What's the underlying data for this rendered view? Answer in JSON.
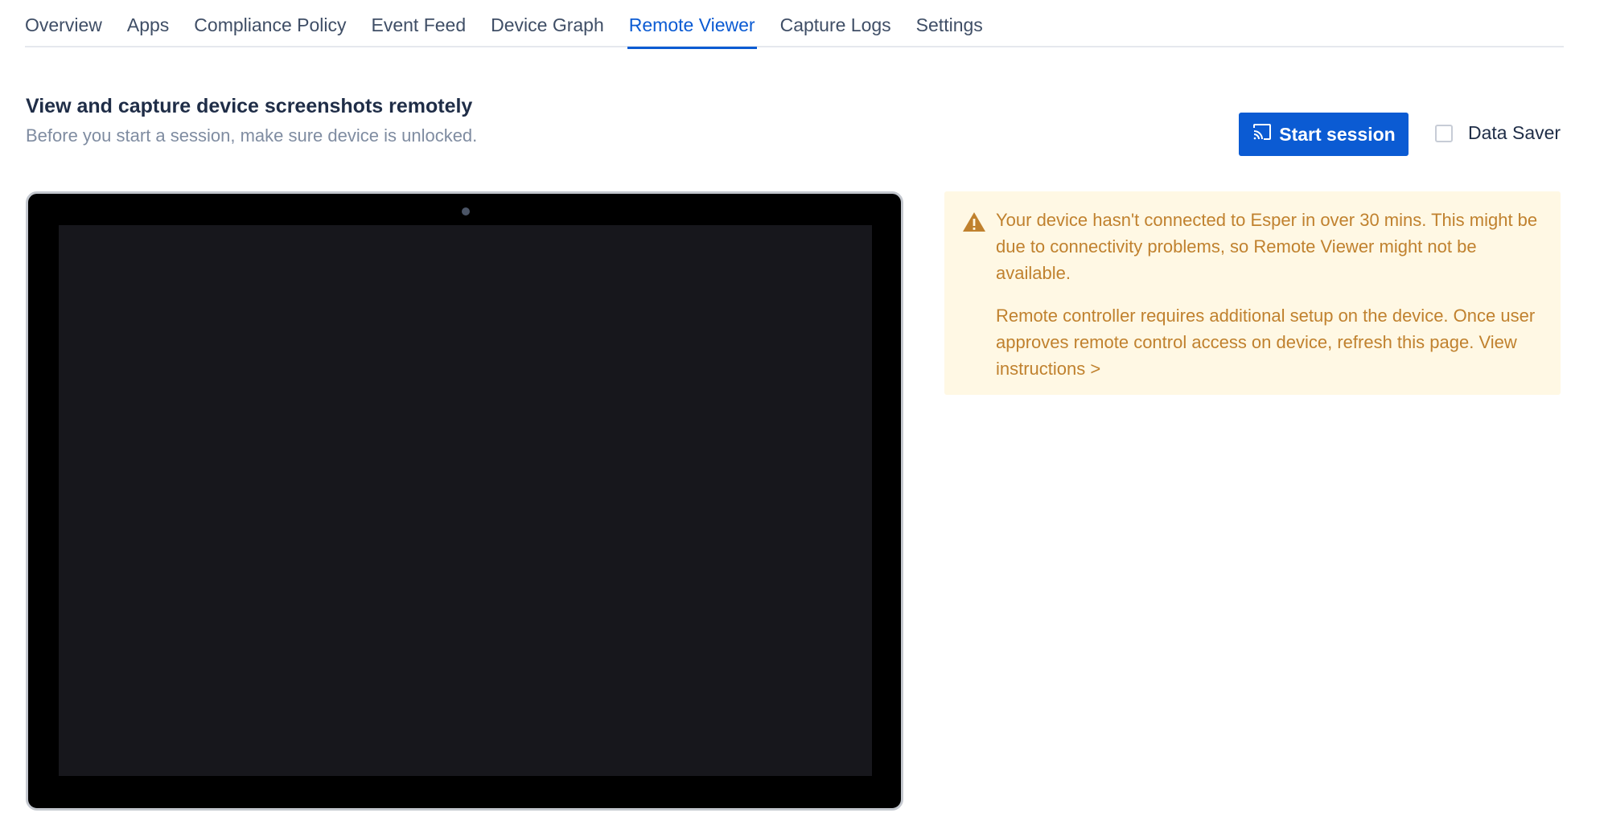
{
  "tabs": [
    {
      "label": "Overview",
      "active": false
    },
    {
      "label": "Apps",
      "active": false
    },
    {
      "label": "Compliance Policy",
      "active": false
    },
    {
      "label": "Event Feed",
      "active": false
    },
    {
      "label": "Device Graph",
      "active": false
    },
    {
      "label": "Remote Viewer",
      "active": true
    },
    {
      "label": "Capture Logs",
      "active": false
    },
    {
      "label": "Settings",
      "active": false
    }
  ],
  "header": {
    "title": "View and capture device screenshots remotely",
    "subtitle": "Before you start a session, make sure device is unlocked."
  },
  "actions": {
    "start_label": "Start session",
    "start_icon": "cast-icon",
    "data_saver_label": "Data Saver",
    "data_saver_checked": false
  },
  "alert": {
    "icon": "warning-icon",
    "message1": "Your device hasn't connected to Esper in over 30 mins. This might be due to connectivity problems, so Remote Viewer might not be available.",
    "message2": "Remote controller requires additional setup on the device. Once user approves remote control access on device, refresh this page.",
    "link_label": "View instructions >"
  },
  "colors": {
    "accent": "#0b5bd3",
    "alert_bg": "#fff8e4",
    "alert_text": "#c0812e",
    "device_screen": "#17171c"
  }
}
